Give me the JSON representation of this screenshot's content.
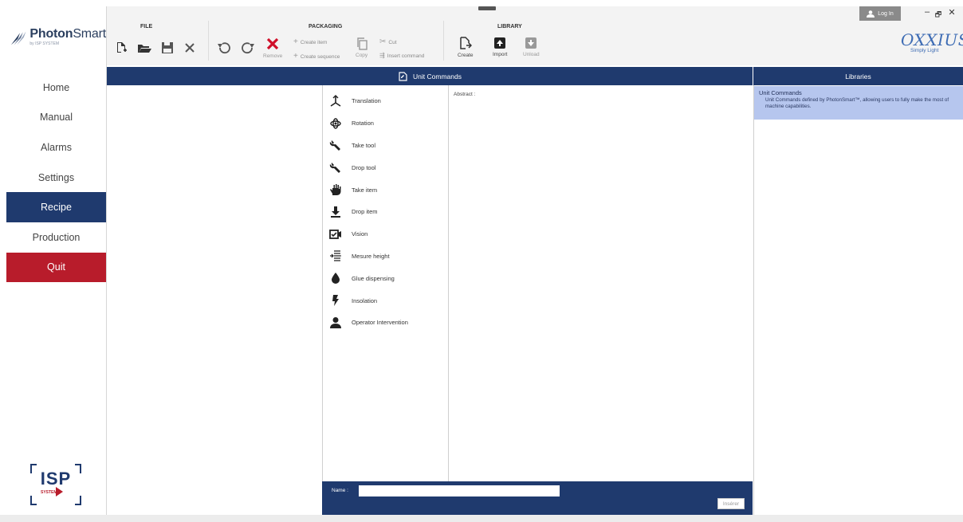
{
  "brand": {
    "name_bold": "Photon",
    "name_rest": "Smart",
    "sub": "by ISP SYSTEM"
  },
  "nav": {
    "home": "Home",
    "manual": "Manual",
    "alarms": "Alarms",
    "settings": "Settings",
    "recipe": "Recipe",
    "production": "Production",
    "quit": "Quit"
  },
  "isp_logo": {
    "text": "ISP",
    "sub": "SYSTEM"
  },
  "ribbon": {
    "file_title": "FILE",
    "packaging_title": "PACKAGING",
    "library_title": "LIBRARY",
    "remove": "Remove",
    "create_item": "Create item",
    "create_sequence": "Create sequence",
    "copy": "Copy",
    "cut": "Cut",
    "insert_command": "Insert command",
    "create": "Create",
    "import": "Import",
    "unload": "Unload"
  },
  "window": {
    "login": "Log In",
    "minimize": "–",
    "restore": "🗗",
    "close": "✕"
  },
  "partner": {
    "logo": "OXXIUS",
    "tagline": "Simply Light"
  },
  "center": {
    "header": "Unit Commands",
    "abstract_label": "Abstract :"
  },
  "commands": [
    {
      "label": "Translation",
      "icon": "translation-icon"
    },
    {
      "label": "Rotation",
      "icon": "rotation-icon"
    },
    {
      "label": "Take tool",
      "icon": "wrench-icon"
    },
    {
      "label": "Drop tool",
      "icon": "wrench-icon"
    },
    {
      "label": "Take item",
      "icon": "hand-icon"
    },
    {
      "label": "Drop item",
      "icon": "download-icon"
    },
    {
      "label": "Vision",
      "icon": "camera-icon"
    },
    {
      "label": "Mesure height",
      "icon": "height-icon"
    },
    {
      "label": "Glue dispensing",
      "icon": "drop-icon"
    },
    {
      "label": "Insolation",
      "icon": "bolt-icon"
    },
    {
      "label": "Operator Intervention",
      "icon": "user-icon"
    }
  ],
  "bottom": {
    "name_label": "Name :",
    "name_value": "",
    "insert": "Insérer"
  },
  "libraries": {
    "header": "Libraries",
    "items": [
      {
        "title": "Unit Commands",
        "desc": "Unit Commands defined by PhotonSmart™, allowing users to fully make the most of machine capabilities."
      }
    ]
  },
  "colors": {
    "primary": "#1f3a6e",
    "quit": "#b81c2b",
    "selected_library": "#b6c6ee",
    "oxxius": "#3e6cb4"
  }
}
